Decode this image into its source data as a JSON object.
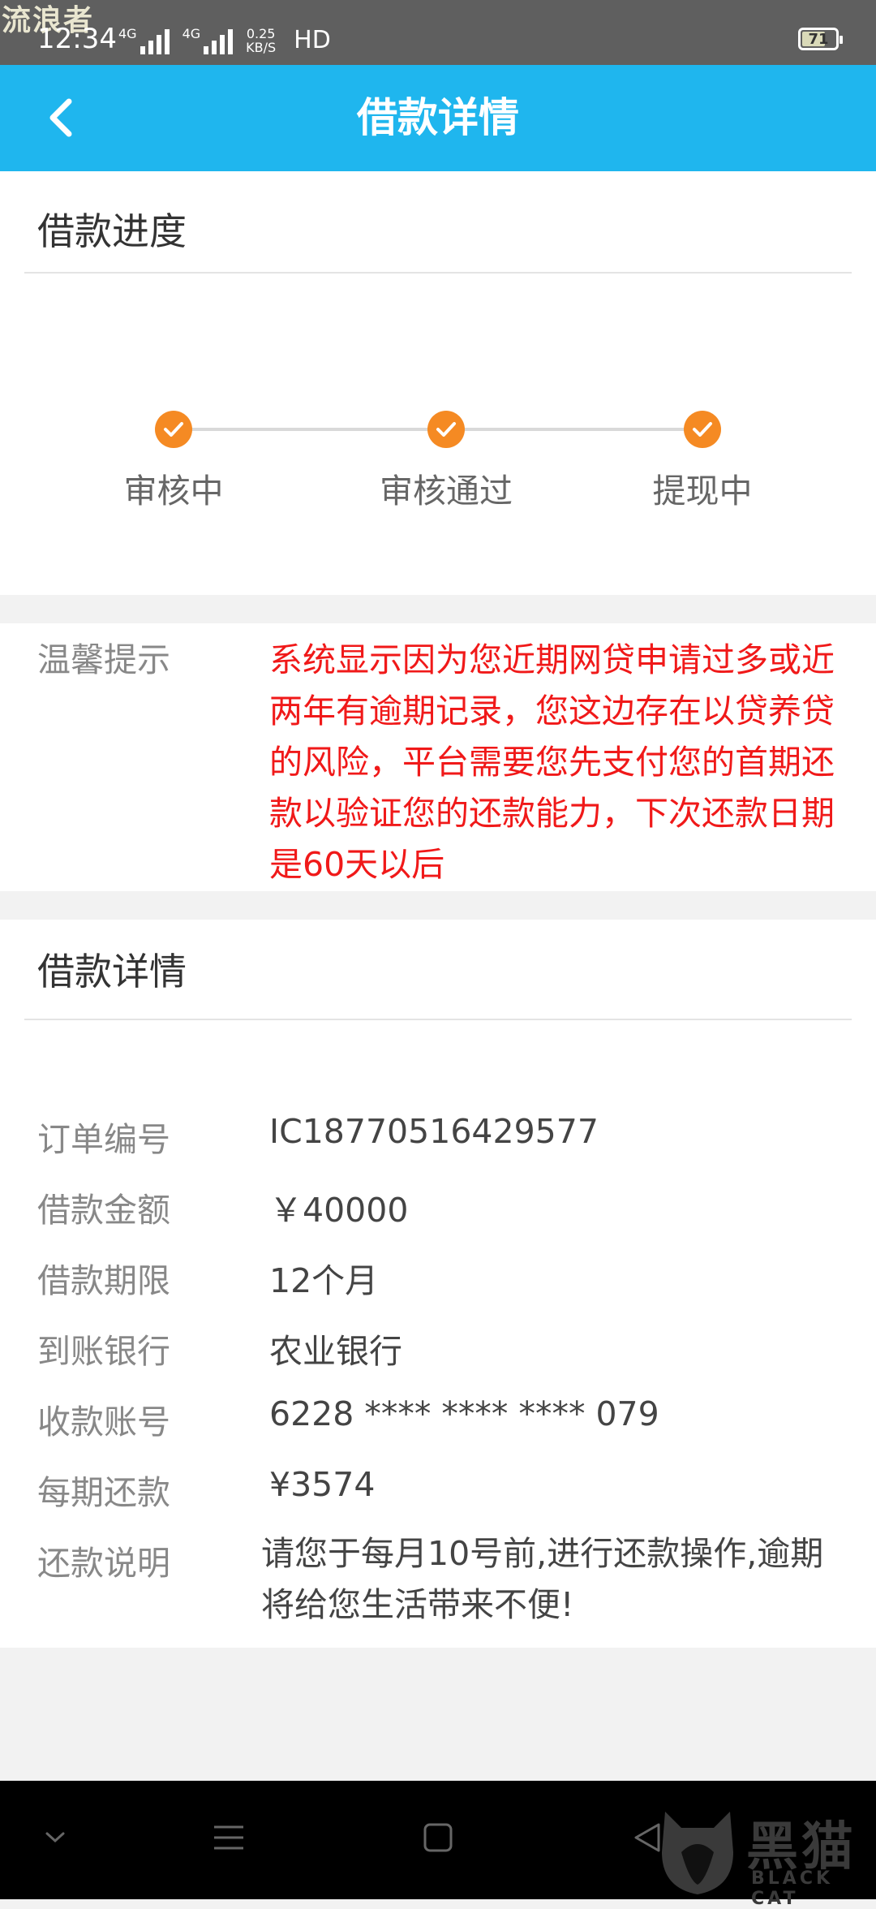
{
  "status_bar": {
    "watermark": "流浪者",
    "time": "12:34",
    "net1": "4G",
    "net2": "4G",
    "speed_value": "0.25",
    "speed_unit": "KB/S",
    "hd": "HD",
    "battery": "71",
    "battery_level_percent": 71
  },
  "header": {
    "title": "借款详情",
    "back_icon": "chevron-left-icon"
  },
  "progress": {
    "title": "借款进度",
    "steps": [
      {
        "label": "审核中",
        "done": true
      },
      {
        "label": "审核通过",
        "done": true
      },
      {
        "label": "提现中",
        "done": true
      }
    ],
    "accent_color": "#f58a23"
  },
  "tip": {
    "label": "温馨提示",
    "text": "系统显示因为您近期网贷申请过多或近两年有逾期记录，您这边存在以贷养贷的风险，平台需要您先支付您的首期还款以验证您的还款能力，下次还款日期是60天以后",
    "color": "#f01919"
  },
  "details": {
    "title": "借款详情",
    "rows": [
      {
        "label": "订单编号",
        "value": "IC18770516429577"
      },
      {
        "label": "借款金额",
        "value": "￥40000"
      },
      {
        "label": "借款期限",
        "value": "12个月"
      },
      {
        "label": "到账银行",
        "value": "农业银行"
      },
      {
        "label": "收款账号",
        "value": "6228 **** **** **** 079"
      },
      {
        "label": "每期还款",
        "value": "¥3574"
      }
    ],
    "note_label": "还款说明",
    "note_value": "请您于每月10号前,进行还款操作,逾期将给您生活带来不便!"
  },
  "nav_bar": {
    "icons": [
      "chevron-down-icon",
      "menu-icon",
      "home-square-icon",
      "back-triangle-icon"
    ],
    "watermark_cn": "黑猫",
    "watermark_en": "BLACK CAT"
  },
  "colors": {
    "header": "#1fb6ee",
    "background": "#f2f2f2"
  }
}
